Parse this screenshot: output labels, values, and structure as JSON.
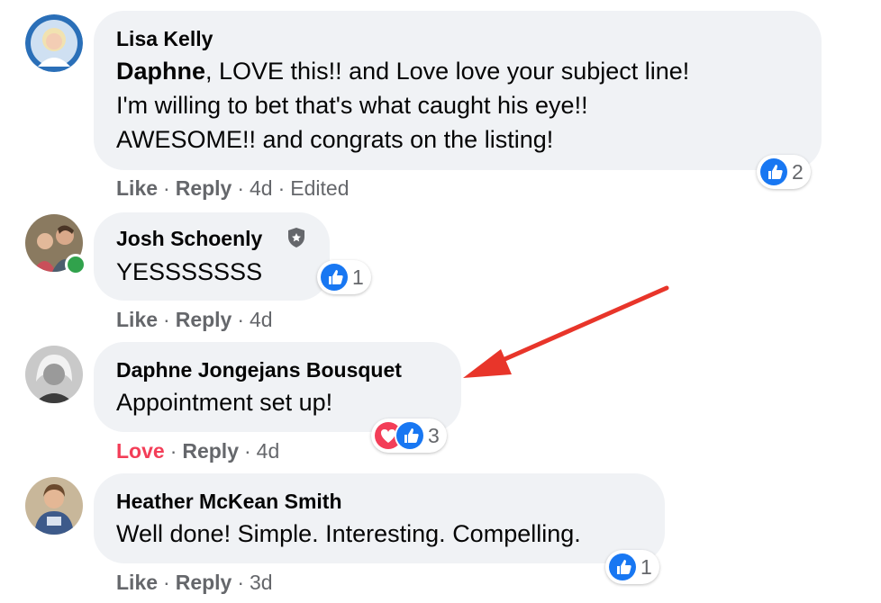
{
  "comments": [
    {
      "author": "Lisa Kelly",
      "mention": "Daphne",
      "lines": [
        ", LOVE this!! and Love love your subject line!",
        "I'm willing to bet that's what caught his eye!!",
        "AWESOME!! and congrats on the listing!"
      ],
      "actions": {
        "like": "Like",
        "reply": "Reply",
        "time": "4d",
        "edited": "Edited"
      },
      "reactions": {
        "icons": [
          "like-icon"
        ],
        "count": "2"
      }
    },
    {
      "author": "Josh Schoenly",
      "badge": "shield-icon",
      "text": "YESSSSSSS",
      "actions": {
        "like": "Like",
        "reply": "Reply",
        "time": "4d"
      },
      "reactions": {
        "icons": [
          "like-icon"
        ],
        "count": "1"
      }
    },
    {
      "author": "Daphne Jongejans Bousquet",
      "text": "Appointment set up!",
      "actions": {
        "like": "Love",
        "reply": "Reply",
        "time": "4d"
      },
      "reactions": {
        "icons": [
          "love-icon",
          "like-icon"
        ],
        "count": "3"
      }
    },
    {
      "author": "Heather McKean Smith",
      "text": "Well done! Simple. Interesting. Compelling.",
      "actions": {
        "like": "Like",
        "reply": "Reply",
        "time": "3d"
      },
      "reactions": {
        "icons": [
          "like-icon"
        ],
        "count": "1"
      }
    }
  ],
  "separator": "·",
  "colors": {
    "bubble": "#f0f2f5",
    "like": "#1877f2",
    "love": "#f33e58",
    "secondary_text": "#65676b",
    "annotation_arrow": "#e8352a",
    "online": "#31a24c"
  }
}
